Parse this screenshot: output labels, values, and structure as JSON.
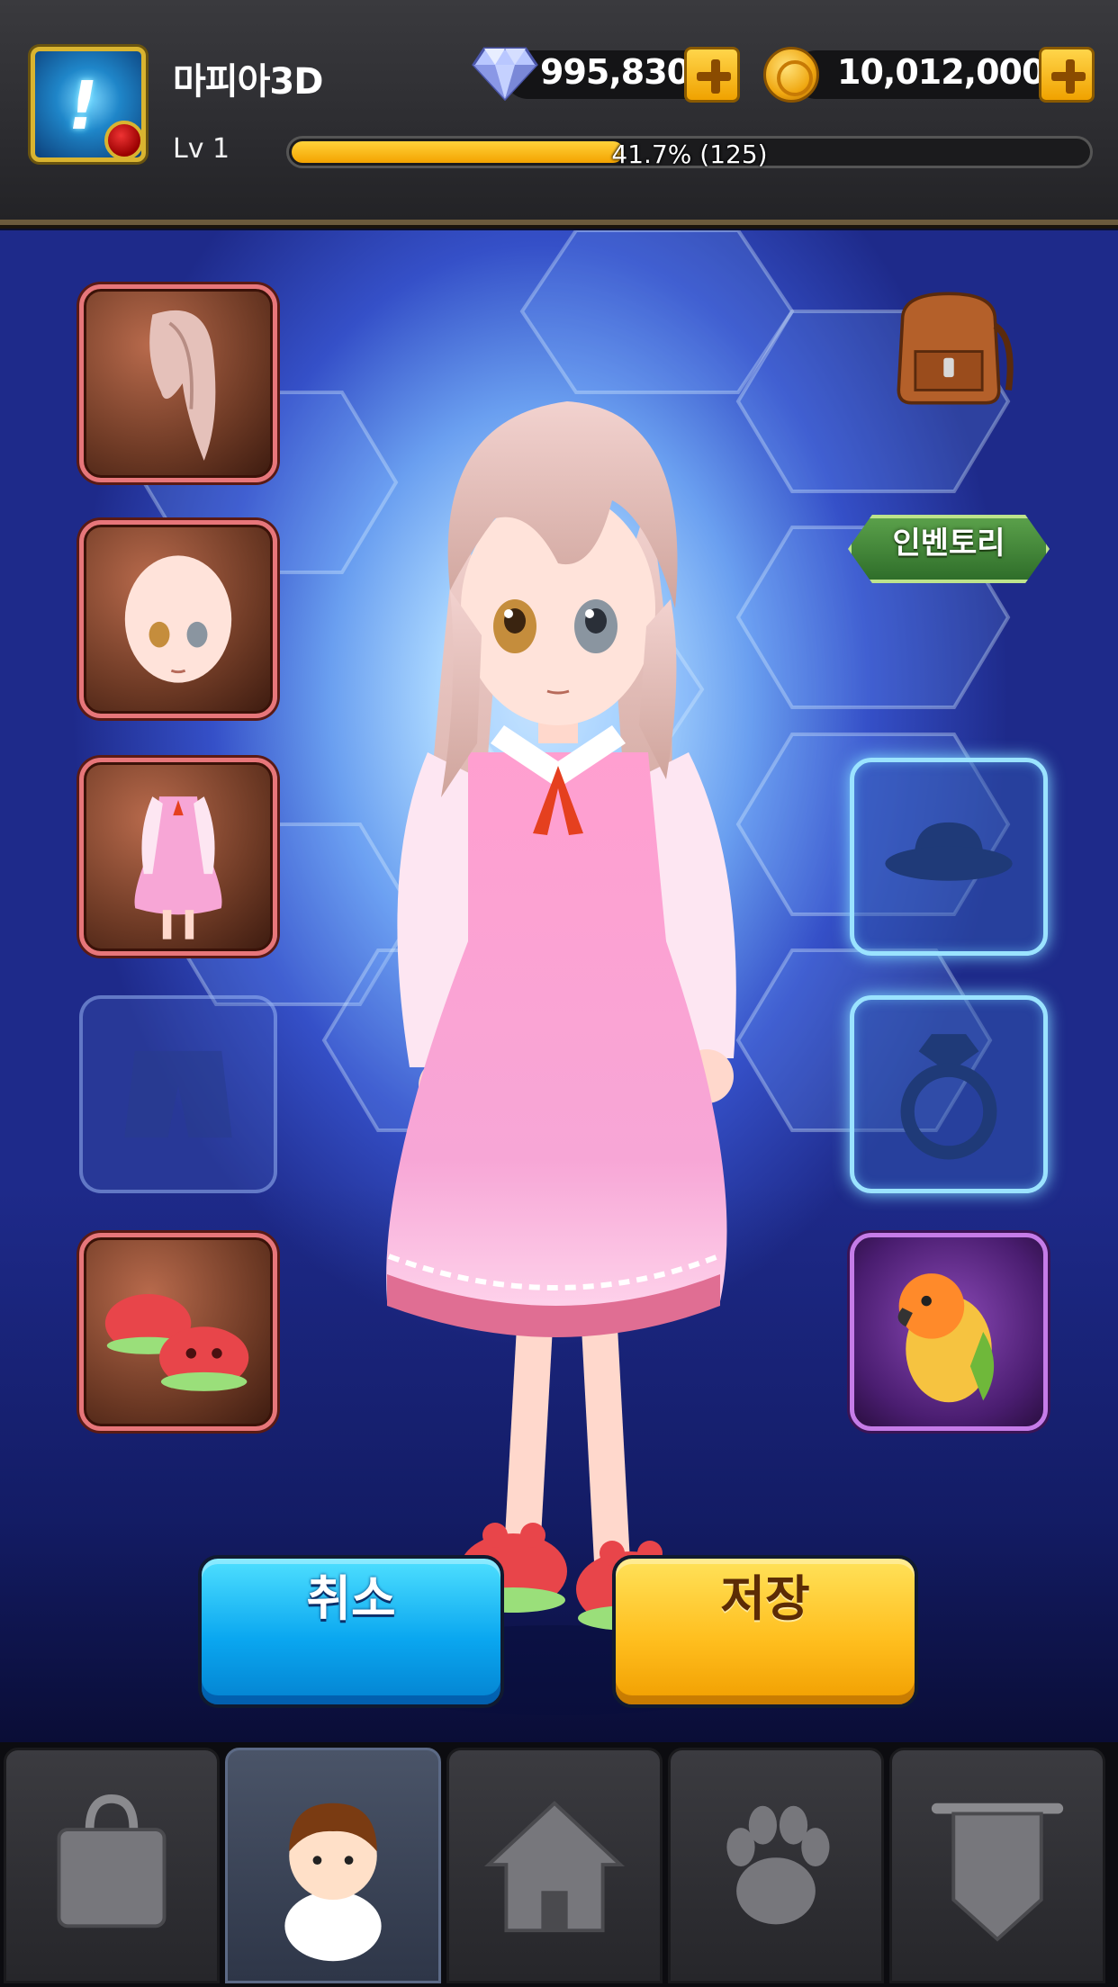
{
  "header": {
    "player_name": "마피아3D",
    "level_label": "Lv 1",
    "xp_progress": 0.417,
    "xp_text": "41.7% (125)",
    "gems": "995,830",
    "coins": "10,012,000",
    "avatar_icon": "exclamation-icon",
    "gem_icon": "diamond-icon",
    "coin_icon": "gold-coin-icon",
    "plus_icon": "plus-icon"
  },
  "equipment": {
    "left_slots": [
      {
        "slot": "hair",
        "state": "equipped"
      },
      {
        "slot": "face",
        "state": "equipped"
      },
      {
        "slot": "outfit",
        "state": "equipped"
      },
      {
        "slot": "pants",
        "state": "empty"
      },
      {
        "slot": "shoes",
        "state": "equipped"
      }
    ],
    "right_slots": [
      {
        "slot": "hat",
        "state": "empty"
      },
      {
        "slot": "ring",
        "state": "empty"
      },
      {
        "slot": "pet",
        "state": "equipped"
      }
    ]
  },
  "inventory": {
    "label": "인벤토리",
    "icon": "backpack-icon"
  },
  "actions": {
    "cancel_label": "취소",
    "save_label": "저장"
  },
  "bottom_nav": {
    "tabs": [
      {
        "name": "shop",
        "icon": "shopping-bag-icon",
        "active": false
      },
      {
        "name": "character",
        "icon": "character-icon",
        "active": true
      },
      {
        "name": "home",
        "icon": "home-icon",
        "active": false
      },
      {
        "name": "pet",
        "icon": "paw-icon",
        "active": false
      },
      {
        "name": "guild",
        "icon": "banner-icon",
        "active": false
      }
    ]
  },
  "colors": {
    "accent_gold": "#f4a300",
    "cancel_blue": "#0aa7f0",
    "save_yellow": "#ffbf1f",
    "slot_red": "#e7767a",
    "slot_pet_purple": "#c57ce8"
  }
}
